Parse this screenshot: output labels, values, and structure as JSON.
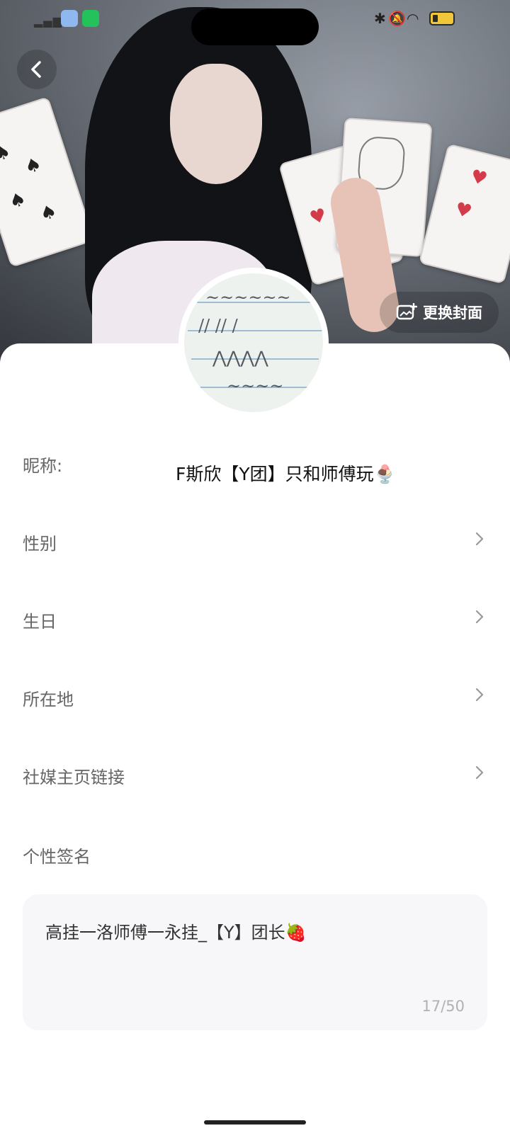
{
  "header": {
    "change_cover_label": "更换封面",
    "back_icon": "chevron-left-icon",
    "image_icon": "image-plus-icon"
  },
  "profile": {
    "nickname_label": "昵称:",
    "nickname_value": "F斯欣【Y团】只和师傅玩🍨",
    "rows": [
      {
        "label": "性别"
      },
      {
        "label": "生日"
      },
      {
        "label": "所在地"
      },
      {
        "label": "社媒主页链接"
      }
    ],
    "signature_label": "个性签名",
    "signature_text": "高挂一洛师傅一永挂_【Y】团长🍓",
    "signature_counter": "17/50"
  },
  "colors": {
    "sheet_bg": "#ffffff",
    "label_gray": "#666666",
    "chevron_gray": "#999999",
    "signature_box_bg": "#f7f7f9"
  }
}
